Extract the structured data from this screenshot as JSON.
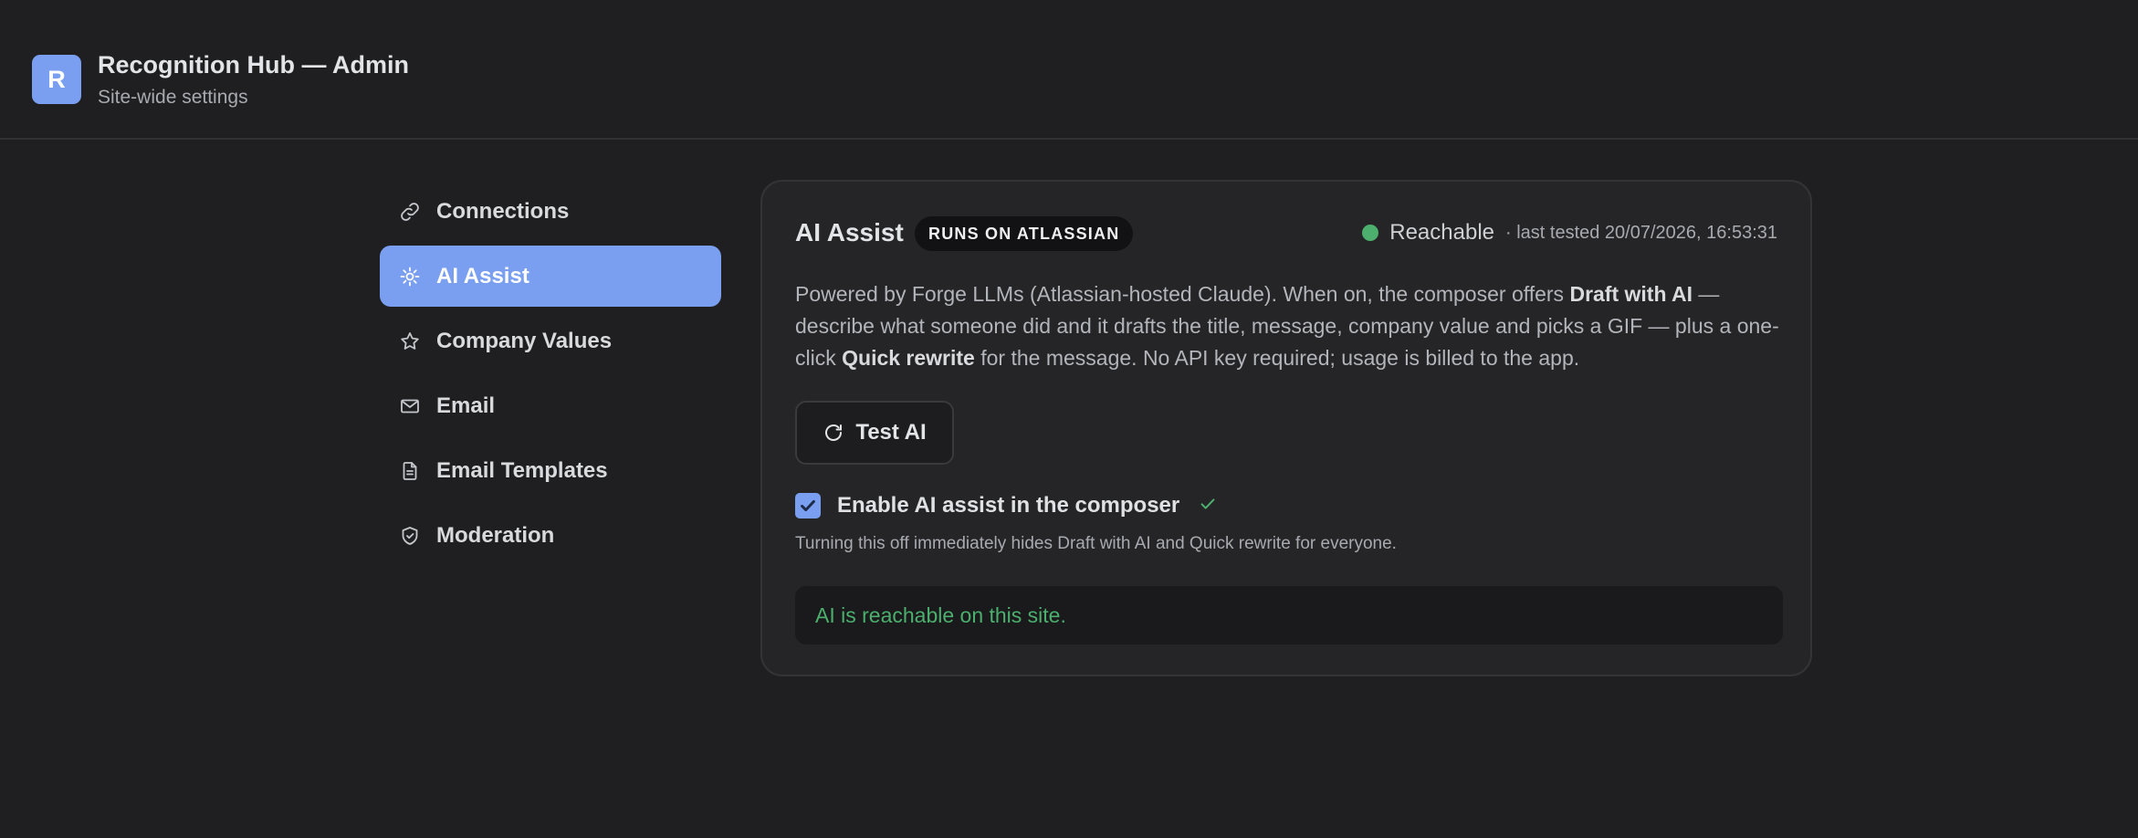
{
  "header": {
    "logo_letter": "R",
    "title": "Recognition Hub — Admin",
    "subtitle": "Site-wide settings"
  },
  "sidebar": {
    "items": [
      {
        "label": "Connections",
        "icon": "link-icon",
        "active": false
      },
      {
        "label": "AI Assist",
        "icon": "sparkle-icon",
        "active": true
      },
      {
        "label": "Company Values",
        "icon": "star-icon",
        "active": false
      },
      {
        "label": "Email",
        "icon": "mail-icon",
        "active": false
      },
      {
        "label": "Email Templates",
        "icon": "document-icon",
        "active": false
      },
      {
        "label": "Moderation",
        "icon": "shield-icon",
        "active": false
      }
    ]
  },
  "card": {
    "title": "AI Assist",
    "badge": "RUNS ON ATLASSIAN",
    "status": {
      "label": "Reachable",
      "last_tested": "· last tested 20/07/2026, 16:53:31",
      "color": "#4caf6e"
    },
    "description": {
      "part1": "Powered by Forge LLMs (Atlassian-hosted Claude). When on, the composer offers ",
      "bold1": "Draft with AI",
      "part2": " — describe what someone did and it drafts the title, message, company value and picks a GIF — plus a one-click ",
      "bold2": "Quick rewrite",
      "part3": " for the message. No API key required; usage is billed to the app."
    },
    "test_button_label": "Test AI",
    "toggle": {
      "label": "Enable AI assist in the composer",
      "checked": true
    },
    "helper_text": "Turning this off immediately hides Draft with AI and Quick rewrite for everyone.",
    "result_message": "AI is reachable on this site."
  },
  "colors": {
    "accent": "#7b9ff0",
    "success": "#4caf6e",
    "background": "#1f1f21",
    "card": "#252528"
  }
}
